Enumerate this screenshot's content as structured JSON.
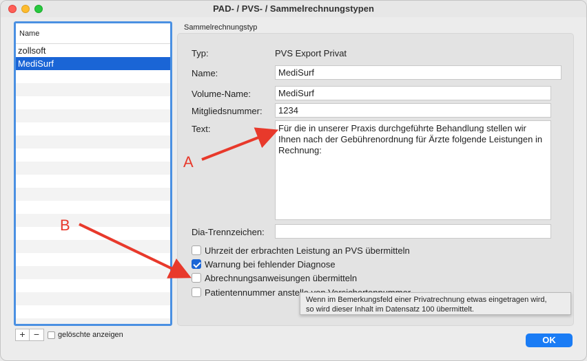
{
  "window": {
    "title": "PAD- / PVS- / Sammelrechnungstypen"
  },
  "list": {
    "header": "Name",
    "items": [
      {
        "label": "zollsoft",
        "selected": false
      },
      {
        "label": "MediSurf",
        "selected": true
      }
    ],
    "add_label": "+",
    "remove_label": "−",
    "show_deleted_label": "gelöschte anzeigen",
    "show_deleted_checked": false
  },
  "form": {
    "group_label": "Sammelrechnungstyp",
    "typ_label": "Typ:",
    "typ_value": "PVS Export Privat",
    "name_label": "Name:",
    "name_value": "MediSurf",
    "volume_label": "Volume-Name:",
    "volume_value": "MediSurf",
    "member_label": "Mitgliedsnummer:",
    "member_value": "1234",
    "text_label": "Text:",
    "text_value": "Für die in unserer Praxis durchgeführte Behandlung stellen wir Ihnen nach der Gebührenordnung für Ärzte folgende Leistungen in Rechnung:",
    "dia_label": "Dia-Trennzeichen:",
    "dia_value": "",
    "checkboxes": [
      {
        "label": "Uhrzeit der erbrachten Leistung an PVS übermitteln",
        "checked": false
      },
      {
        "label": "Warnung bei fehlender Diagnose",
        "checked": true
      },
      {
        "label": "Abrechnungsanweisungen übermitteln",
        "checked": false
      },
      {
        "label": "Patientennummer anstelle von Versichertennummer",
        "checked": false
      }
    ]
  },
  "tooltip": {
    "line1": "Wenn im Bemerkungsfeld einer Privatrechnung etwas eingetragen wird,",
    "line2": "so wird dieser Inhalt im Datensatz 100 übermittelt."
  },
  "ok_label": "OK",
  "annotations": {
    "a_label": "A",
    "b_label": "B",
    "color": "#e8392b"
  }
}
